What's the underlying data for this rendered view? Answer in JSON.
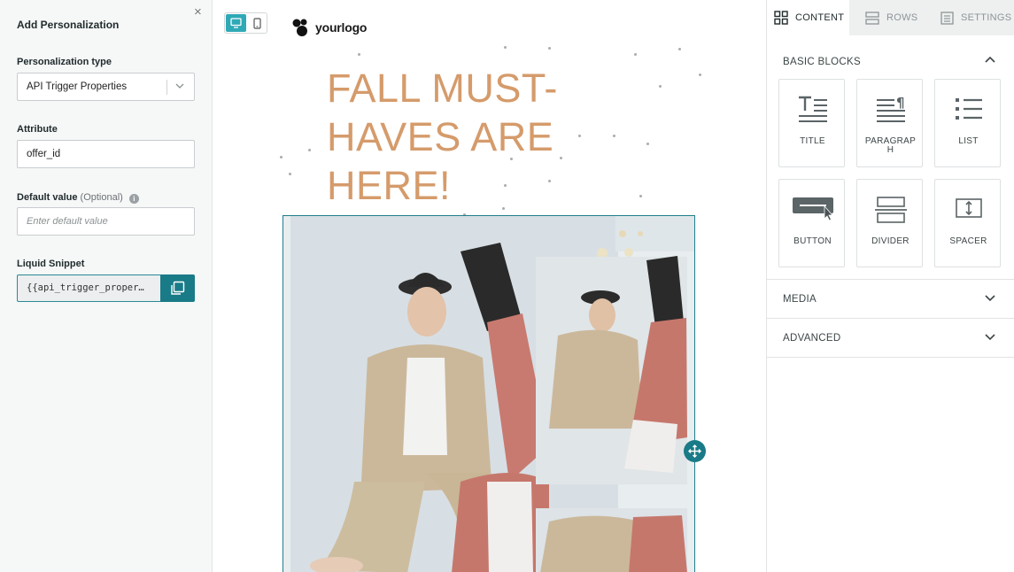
{
  "personalization_panel": {
    "title": "Add Personalization",
    "close_glyph": "×",
    "type_label": "Personalization type",
    "type_value": "API Trigger Properties",
    "attribute_label": "Attribute",
    "attribute_value": "offer_id",
    "default_label": "Default value",
    "default_optional": "(Optional)",
    "default_placeholder": "Enter default value",
    "snippet_label": "Liquid Snippet",
    "snippet_value": "{{api_trigger_proper…"
  },
  "canvas": {
    "logo_text": "yourlogo",
    "headline_lines": [
      "FALL MUST-",
      "HAVES ARE",
      "HERE!"
    ],
    "headline_color": "#d59b6b",
    "accent": "#197b87"
  },
  "sidebar": {
    "tabs": [
      {
        "label": "CONTENT",
        "icon": "grid-icon"
      },
      {
        "label": "ROWS",
        "icon": "rows-icon"
      },
      {
        "label": "SETTINGS",
        "icon": "settings-icon"
      }
    ],
    "basic_blocks_label": "BASIC BLOCKS",
    "blocks": [
      {
        "label": "TITLE",
        "icon": "title-icon"
      },
      {
        "label": "PARAGRAPH",
        "icon": "paragraph-icon"
      },
      {
        "label": "LIST",
        "icon": "list-icon"
      },
      {
        "label": "BUTTON",
        "icon": "button-icon"
      },
      {
        "label": "DIVIDER",
        "icon": "divider-icon"
      },
      {
        "label": "SPACER",
        "icon": "spacer-icon"
      }
    ],
    "media_label": "MEDIA",
    "advanced_label": "ADVANCED"
  }
}
